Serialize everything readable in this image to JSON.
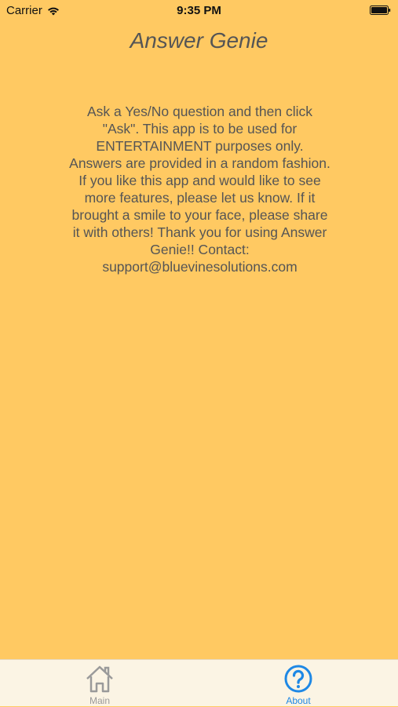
{
  "status_bar": {
    "carrier": "Carrier",
    "time": "9:35 PM",
    "wifi_icon": "wifi-icon",
    "battery_icon": "battery-icon"
  },
  "header": {
    "title": "Answer Genie"
  },
  "about": {
    "text": "Ask a Yes/No question and then click \"Ask\". This app is to be used for ENTERTAINMENT purposes only. Answers are provided in a random fashion. If you like this app and would like to see more features, please let us know. If it brought a smile to your face, please share it with others! Thank you for using Answer Genie!! Contact: support@bluevinesolutions.com"
  },
  "tab_bar": {
    "tabs": [
      {
        "label": "Main",
        "icon": "home-icon",
        "selected": false
      },
      {
        "label": "About",
        "icon": "question-circle-icon",
        "selected": true
      }
    ]
  },
  "colors": {
    "background": "#FFC962",
    "tab_bar_background": "#FBF4E4",
    "text": "#555555",
    "tab_inactive": "#9A9A9A",
    "tab_active": "#1E88E5"
  }
}
